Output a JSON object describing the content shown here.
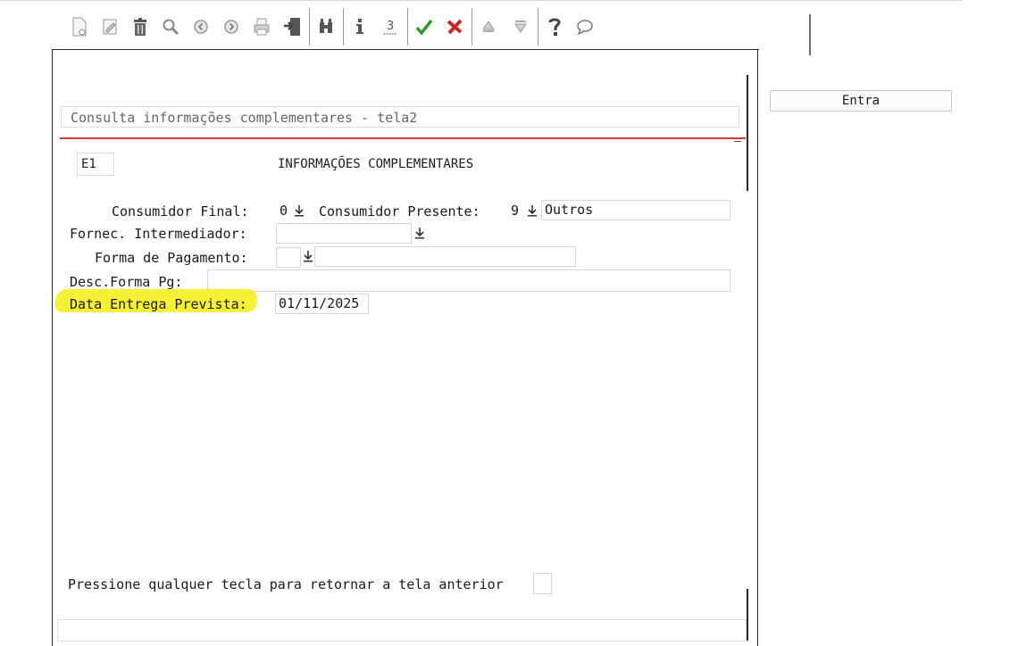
{
  "screen": {
    "title": "Consulta informações complementares - tela2",
    "code": "E1",
    "header": "INFORMAÇÕES COMPLEMENTARES"
  },
  "toolbar": {
    "icons": [
      "new-document-icon",
      "edit-icon",
      "trash-icon",
      "search-icon",
      "previous-icon",
      "next-icon",
      "print-icon",
      "exit-icon",
      "binoculars-icon",
      "info-icon",
      "calendar-icon",
      "confirm-icon",
      "cancel-icon",
      "up-icon",
      "down-icon",
      "help-icon",
      "comment-icon"
    ]
  },
  "fields": {
    "consumidor_final_label": "Consumidor Final:",
    "consumidor_final_value": "0",
    "consumidor_presente_label": "Consumidor Presente:",
    "consumidor_presente_value": "9",
    "consumidor_presente_desc": "Outros",
    "fornec_label": "Fornec. Intermediador:",
    "fornec_value": "",
    "forma_pag_label": "Forma de Pagamento:",
    "forma_pag_value": "",
    "forma_pag_desc": "",
    "desc_forma_label": "Desc.Forma Pg:",
    "desc_forma_value": "",
    "data_entrega_label": "Data Entrega Prevista:",
    "data_entrega_value": "01/11/2025"
  },
  "footer": {
    "prompt": "Pressione qualquer tecla para retornar a tela anterior"
  },
  "actions": {
    "entra_label": "Entra"
  },
  "colors": {
    "highlight": "#f5ef2c",
    "separator_red": "#d23a3a",
    "confirm_green": "#2e9a2e",
    "cancel_red": "#c62828"
  }
}
